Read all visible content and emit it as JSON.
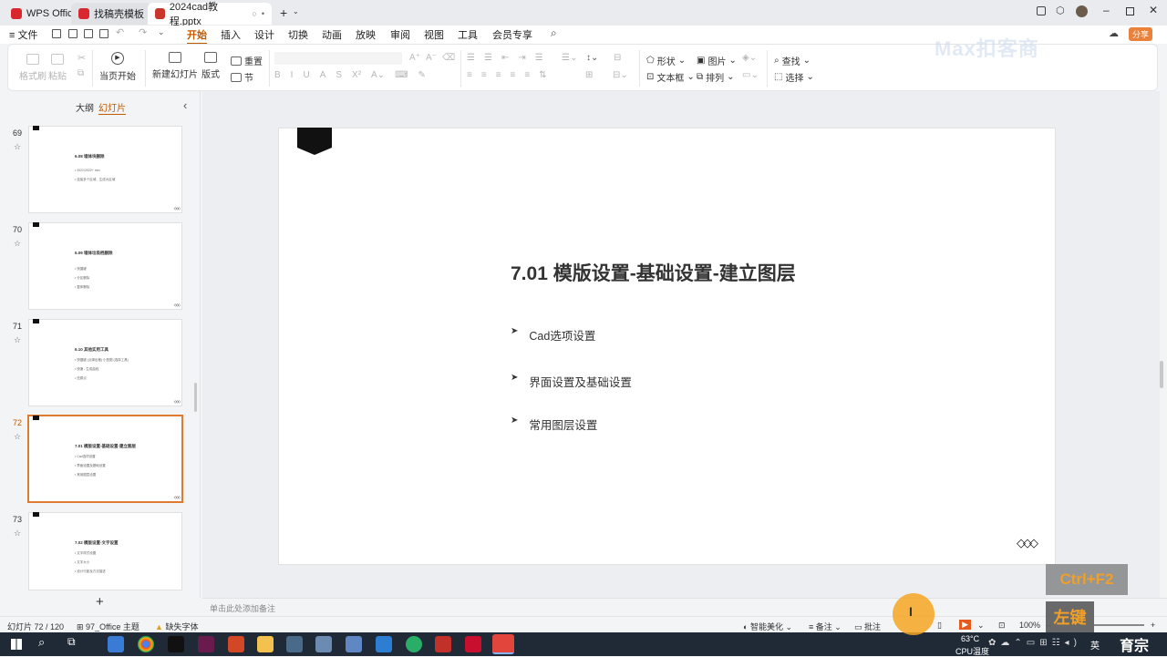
{
  "tabs": [
    {
      "label": "WPS Office",
      "color": "#d9272e"
    },
    {
      "label": "找稿壳模板",
      "color": "#d9272e"
    },
    {
      "label": "2024cad教程.pptx",
      "color": "#c9352a"
    }
  ],
  "menu": {
    "file": "文件",
    "items": [
      "开始",
      "插入",
      "设计",
      "切换",
      "动画",
      "放映",
      "审阅",
      "视图",
      "工具",
      "会员专享"
    ],
    "active": "开始",
    "share": "分享"
  },
  "ribbon": {
    "format_painter": "格式刷",
    "paste": "粘贴",
    "start_from_current": "当页开始",
    "new_slide": "新建幻灯片",
    "layout": "版式",
    "reset": "重置",
    "section": "节",
    "shape": "形状",
    "picture": "图片",
    "textbox": "文本框",
    "arrange": "排列",
    "find": "查找",
    "select": "选择"
  },
  "panel": {
    "outline": "大纲",
    "slides": "幻灯片",
    "collapse": "‹"
  },
  "thumbnails": [
    {
      "num": "69",
      "title": "6.08 墙体块删除",
      "lines": [
        "• 2021/2022+ mm",
        "• 连接多个区域、生成大区域"
      ]
    },
    {
      "num": "70",
      "title": "6.09 墙体垃圾档删除",
      "lines": [
        "• 快捷键",
        "• 分区删除",
        "• 整体删除"
      ]
    },
    {
      "num": "71",
      "title": "6.10 其他实用工具",
      "lines": [
        "• 快捷键 (点弹出格) 小型图 (选择工具)",
        "• 快速 - 生成曲线",
        "• 还原点"
      ]
    },
    {
      "num": "72",
      "title": "7.01 模版设置-基础设置-建立图层",
      "lines": [
        "• Cad选项设置",
        "• 界面设置及基础设置",
        "• 常用图层设置"
      ],
      "selected": true
    },
    {
      "num": "73",
      "title": "7.02 模版设置-文字设置",
      "lines": [
        "• 文字样式设置",
        "• 文字大小",
        "• 设计行距及方法描述"
      ]
    }
  ],
  "slide": {
    "title": "7.01 模版设置-基础设置-建立图层",
    "bullets": [
      "Cad选项设置",
      "界面设置及基础设置",
      "常用图层设置"
    ],
    "deco": "◇◇◇"
  },
  "notes_placeholder": "单击此处添加备注",
  "status": {
    "slide_counter": "幻灯片 72 / 120",
    "theme": "97_Office 主题",
    "missing_font": "缺失字体",
    "smart_beautify": "智能美化",
    "notes": "备注",
    "comments": "批注",
    "zoom": "100%"
  },
  "taskbar": {
    "temp": "63°C",
    "cpu": "CPU温度",
    "ime": "英"
  },
  "overlay": {
    "shortcut": "Ctrl+F2",
    "key": "左键",
    "watermark": "Max扣客商",
    "brand": "育宗"
  }
}
